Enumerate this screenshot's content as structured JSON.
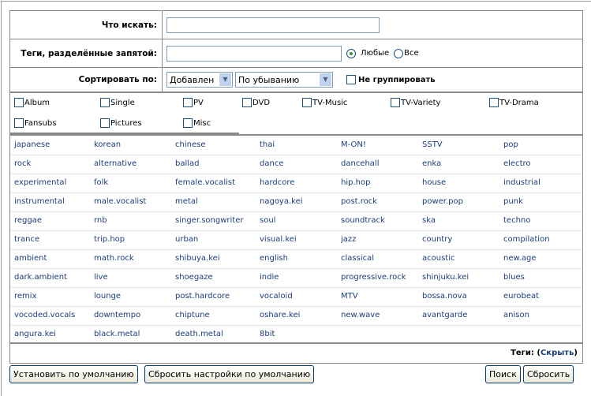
{
  "form": {
    "what_label": "Что искать:",
    "what_value": "",
    "tags_label": "Теги, разделённые запятой:",
    "tags_value": "",
    "any_label": "Любые",
    "all_label": "Все",
    "sort_label": "Сортировать по:",
    "sort_by": "Добавлен",
    "sort_order": "По убыванию",
    "nogroup_label": "Не группировать"
  },
  "categories": [
    "Album",
    "Single",
    "PV",
    "DVD",
    "TV-Music",
    "TV-Variety",
    "TV-Drama",
    "Fansubs",
    "Pictures",
    "Misc"
  ],
  "tags": [
    [
      "japanese",
      "korean",
      "chinese",
      "thai",
      "M-ON!",
      "SSTV",
      "pop"
    ],
    [
      "rock",
      "alternative",
      "ballad",
      "dance",
      "dancehall",
      "enka",
      "electro"
    ],
    [
      "experimental",
      "folk",
      "female.vocalist",
      "hardcore",
      "hip.hop",
      "house",
      "industrial"
    ],
    [
      "instrumental",
      "male.vocalist",
      "metal",
      "nagoya.kei",
      "post.rock",
      "power.pop",
      "punk"
    ],
    [
      "reggae",
      "rnb",
      "singer.songwriter",
      "soul",
      "soundtrack",
      "ska",
      "techno"
    ],
    [
      "trance",
      "trip.hop",
      "urban",
      "visual.kei",
      "jazz",
      "country",
      "compilation"
    ],
    [
      "ambient",
      "math.rock",
      "shibuya.kei",
      "english",
      "classical",
      "acoustic",
      "new.age"
    ],
    [
      "dark.ambient",
      "live",
      "shoegaze",
      "indie",
      "progressive.rock",
      "shinjuku.kei",
      "blues"
    ],
    [
      "remix",
      "lounge",
      "post.hardcore",
      "vocaloid",
      "MTV",
      "bossa.nova",
      "eurobeat"
    ],
    [
      "vocoded.vocals",
      "downtempo",
      "chiptune",
      "oshare.kei",
      "new.wave",
      "avantgarde",
      "anison"
    ],
    [
      "angura.kei",
      "black.metal",
      "death.metal",
      "8bit"
    ]
  ],
  "footer": {
    "tags_label": "Теги:",
    "hide_open": "(",
    "hide_link": "Скрыть",
    "hide_close": ")"
  },
  "buttons": {
    "set_default": "Установить по умолчанию",
    "reset_default": "Сбросить настройки по умолчанию",
    "search": "Поиск",
    "reset": "Сбросить"
  }
}
